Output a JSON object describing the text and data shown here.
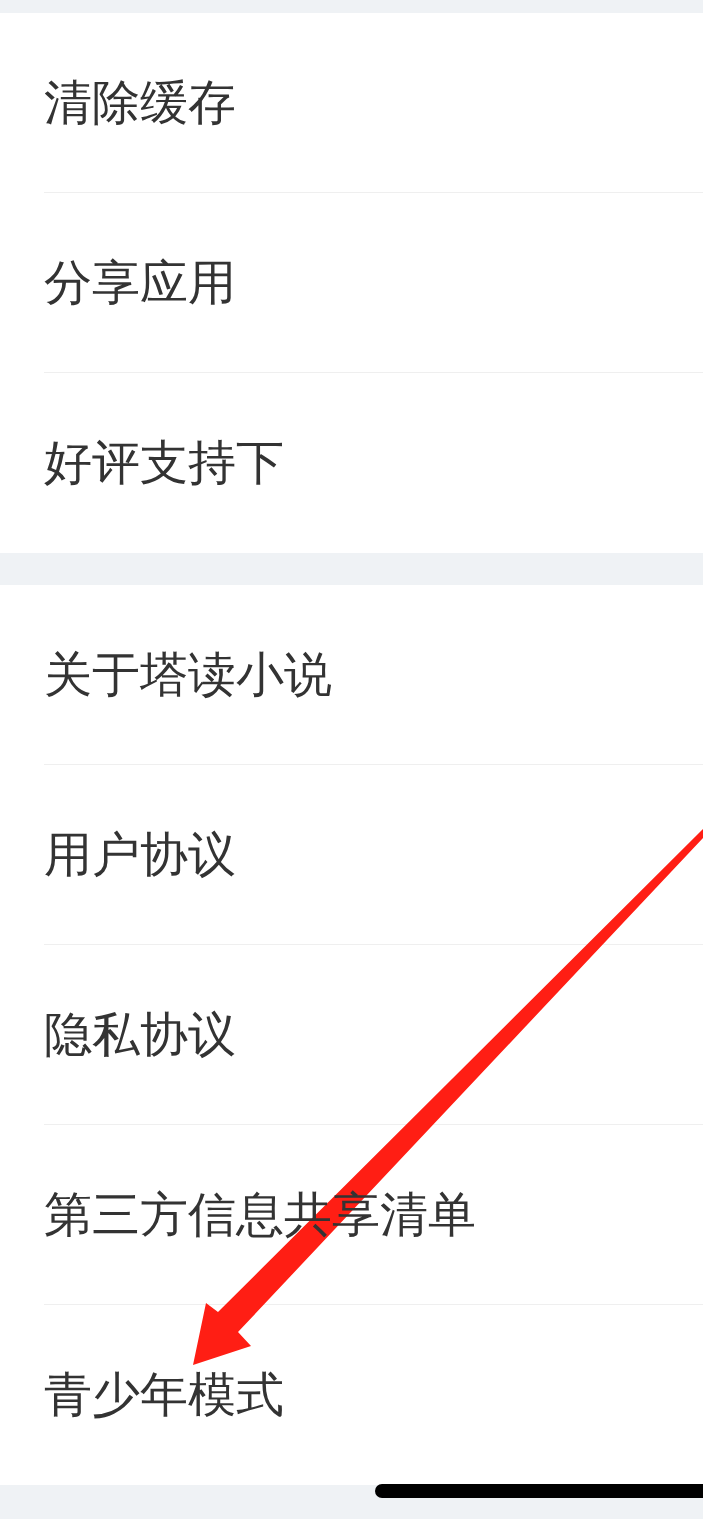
{
  "sections": [
    {
      "items": [
        {
          "label": "清除缓存"
        },
        {
          "label": "分享应用"
        },
        {
          "label": "好评支持下"
        }
      ]
    },
    {
      "items": [
        {
          "label": "关于塔读小说"
        },
        {
          "label": "用户协议"
        },
        {
          "label": "隐私协议"
        },
        {
          "label": "第三方信息共享清单"
        },
        {
          "label": "青少年模式"
        }
      ]
    }
  ]
}
